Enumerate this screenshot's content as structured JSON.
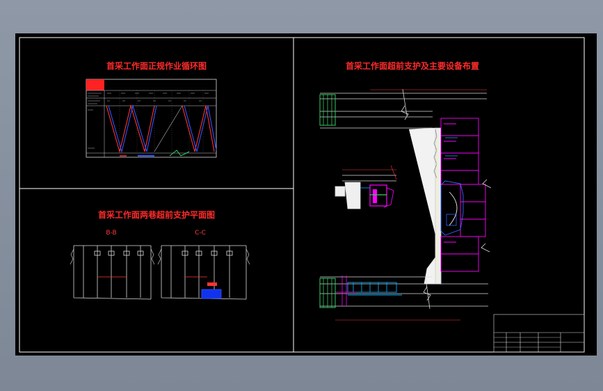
{
  "titles": {
    "cycle_chart": "首采工作面正规作业循环图",
    "layout": "首采工作面超前支护及主要设备布置",
    "plan": "首采工作面两巷超前支护平面图"
  },
  "sections": {
    "b": "B-B",
    "c": "C-C"
  },
  "colors": {
    "background": "#000000",
    "frame": "#ffffff",
    "title": "#ff2b2b",
    "section_label": "#ff4a4a",
    "equipment": "#ff00ff",
    "roadway": "#00aaff",
    "cutting_line": "#ffff00",
    "support_green": "#33cc66",
    "window_bg": "#7f8a99"
  }
}
